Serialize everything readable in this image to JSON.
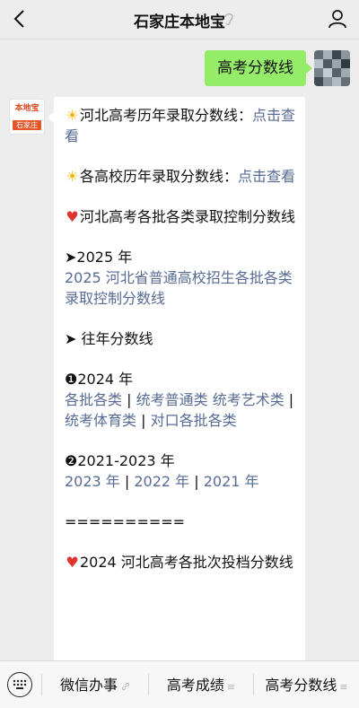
{
  "header": {
    "title": "石家庄本地宝",
    "back_icon": "chevron-left-icon",
    "ear_icon": "ear-icon",
    "profile_icon": "person-icon"
  },
  "chat": {
    "outgoing": {
      "text": "高考分数线"
    },
    "account_avatar": {
      "logo_text": "本地宝",
      "logo_sub": "石家庄"
    },
    "incoming": {
      "l1_text": "河北高考历年录取分数线：",
      "l1_link": "点击查看",
      "l2_text": "各高校历年录取分数线：",
      "l2_link": "点击查看",
      "l3_text": "河北高考各批各类录取控制分数线",
      "l4_head": "➤2025 年",
      "l4_link": "2025 河北省普通高校招生各批各类录取控制分数线",
      "l5_head": "➤ 往年分数线",
      "l6_head": "❶2024 年",
      "l6_link1": "各批各类",
      "l6_link2": "统考普通类",
      "l6_link3": "统考艺术类",
      "l6_link4": "统考体育类",
      "l6_link5": "对口各批各类",
      "l7_head": "❷2021-2023 年",
      "l7_link1": "2023 年",
      "l7_link2": "2022 年",
      "l7_link3": "2021 年",
      "separator": "==========",
      "l8_text": "2024 河北高考各批次投档分数线",
      "sep_bar": " | "
    }
  },
  "bottom_menu": {
    "keyboard_icon": "keyboard-icon",
    "item1": "微信办事",
    "item1_suffix": "link-icon",
    "item2": "高考成绩",
    "item3": "高考分数线",
    "menu_suffix": "≡"
  },
  "colors": {
    "link": "#576b95",
    "outgoing_bubble": "#95ec69",
    "background": "#ededed"
  }
}
